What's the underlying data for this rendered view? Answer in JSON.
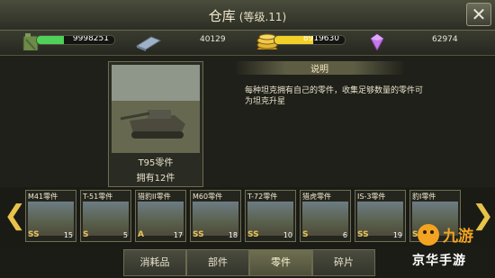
{
  "header": {
    "title": "仓库",
    "level": "(等级.11)"
  },
  "resources": {
    "fuel": {
      "value": "9998251",
      "fill": 0.35,
      "color": "#4fd15a"
    },
    "steel": {
      "value": "40129"
    },
    "gold": {
      "value": "8919630",
      "fill": 0.55,
      "color": "#f2d028"
    },
    "gem": {
      "value": "62974"
    }
  },
  "selected": {
    "name": "T95零件",
    "count": "拥有12件"
  },
  "info": {
    "heading": "说明",
    "text": "每种坦克拥有自己的零件，收集足够数量的零件可为坦克升星"
  },
  "parts": [
    {
      "label": "M41零件",
      "rank": "SS",
      "count": "15"
    },
    {
      "label": "T-51零件",
      "rank": "S",
      "count": "5"
    },
    {
      "label": "猎豹II零件",
      "rank": "A",
      "count": "17"
    },
    {
      "label": "M60零件",
      "rank": "SS",
      "count": "18"
    },
    {
      "label": "T-72零件",
      "rank": "SS",
      "count": "10"
    },
    {
      "label": "猎虎零件",
      "rank": "S",
      "count": "6"
    },
    {
      "label": "IS-3零件",
      "rank": "SS",
      "count": "19"
    },
    {
      "label": "豹I零件",
      "rank": "S",
      "count": ""
    }
  ],
  "tabs": [
    "消耗品",
    "部件",
    "零件",
    "碎片"
  ],
  "watermark": {
    "text": "京华手游",
    "logo": "九游"
  }
}
